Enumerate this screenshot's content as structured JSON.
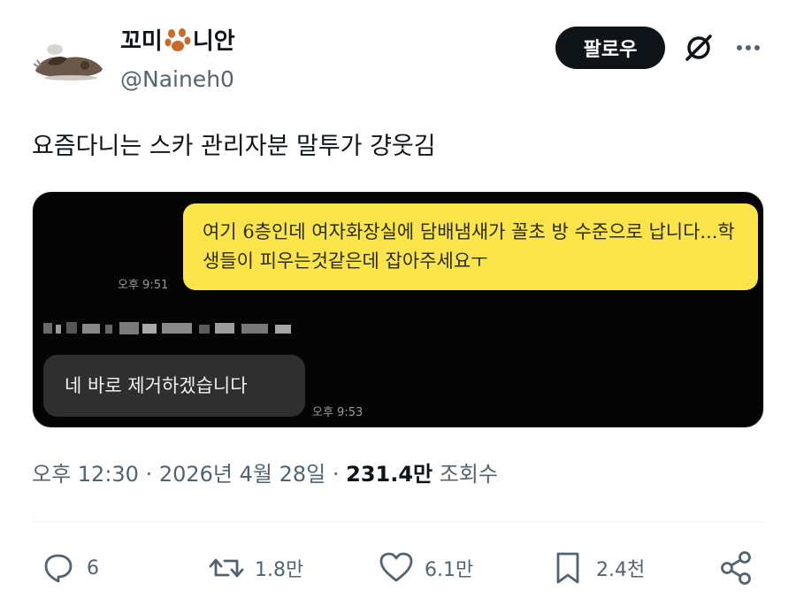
{
  "user": {
    "name_part1": "꼬미",
    "name_part2": "니안",
    "paw_icon": "paw-emoji",
    "handle": "@Naineh0"
  },
  "buttons": {
    "follow": "팔로우",
    "grok_icon": "grok-icon",
    "more_icon": "more-dots-icon"
  },
  "tweet": {
    "text": "요즘다니는 스카 관리자분 말투가 걍웃김"
  },
  "media": {
    "message_1": "여기 6층인데 여자화장실에 담배냄새가 꼴초 방 수준으로 납니다...학생들이 피우는것같은데 잡아주세요ㅜ",
    "time_1": "오후 9:51",
    "message_2": "네 바로 제거하겠습니다",
    "time_2": "오후 9:53",
    "colors": {
      "my_bubble": "#fbe54a",
      "their_bubble": "#2f2f2f",
      "background": "#050505"
    }
  },
  "meta": {
    "time": "오후 12:30",
    "separator": " · ",
    "date": "2026년 4월 28일",
    "views": "231.4만",
    "views_label": "조회수"
  },
  "actions": {
    "reply_count": "6",
    "retweet_count": "1.8만",
    "like_count": "6.1만",
    "bookmark_count": "2.4천"
  }
}
